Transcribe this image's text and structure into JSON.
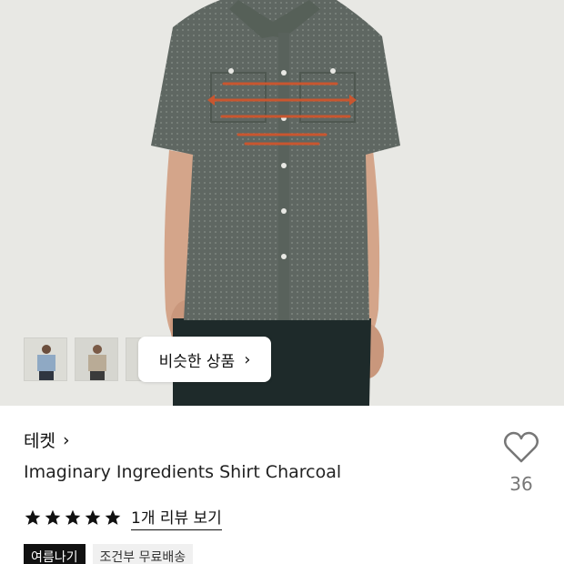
{
  "gallery": {
    "similar_button_label": "비슷한 상품",
    "thumbnails": [
      "thumbnail-1",
      "thumbnail-2",
      "thumbnail-3"
    ]
  },
  "product": {
    "brand": "테켓",
    "name": "Imaginary Ingredients Shirt Charcoal",
    "rating": 5,
    "review_link": "1개 리뷰 보기",
    "like_count": "36",
    "badges": [
      "여름나기",
      "조건부 무료배송"
    ]
  },
  "icons": {
    "brand_chevron": "chevron-right-icon",
    "similar_chevron": "chevron-right-icon",
    "like": "heart-icon",
    "star": "star-icon"
  },
  "colors": {
    "hero_bg": "#e8e8e4",
    "shirt": "#5f6762",
    "print_text": "#c9562f",
    "star": "#111111"
  }
}
